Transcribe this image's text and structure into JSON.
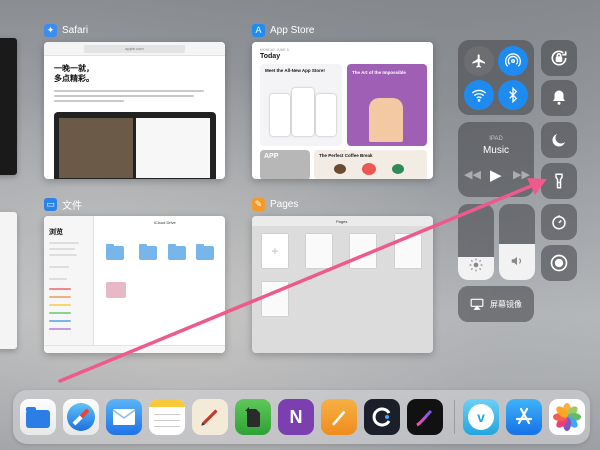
{
  "app_switcher": {
    "safari": {
      "name": "Safari",
      "url": "apple.com",
      "headline_line1": "一晚一就，",
      "headline_line2": "多点精彩。"
    },
    "app_store": {
      "name": "App Store",
      "date": "MONDAY, JUNE 5",
      "today": "Today",
      "card1_title": "Meet the All-New App Store!",
      "card2_title": "The Art of the Impossible",
      "card3_title": "APP",
      "card4_title": "The Perfect Coffee Break"
    },
    "files": {
      "name": "文件",
      "sidebar_title": "浏览",
      "folder_header": "iCloud Drive"
    },
    "pages": {
      "name": "Pages",
      "doc_title": "Pages"
    }
  },
  "control_center": {
    "media_device": "IPAD",
    "media_title": "Music",
    "screen_mirroring": "屏幕镜像",
    "brightness_level": 0.3,
    "volume_level": 0.48
  },
  "dock": {
    "apps": [
      "files-icon",
      "safari-icon",
      "mail-icon",
      "notes-icon",
      "write-icon",
      "evernote-icon",
      "onenote-icon",
      "pages-icon",
      "cleanmaster-icon",
      "procreate-icon",
      "vimeo-icon",
      "app-store-icon",
      "photos-icon"
    ]
  },
  "colors": {
    "connectivity_blue": "#1e8bf0",
    "arrow_pink": "#ee5a8c"
  }
}
